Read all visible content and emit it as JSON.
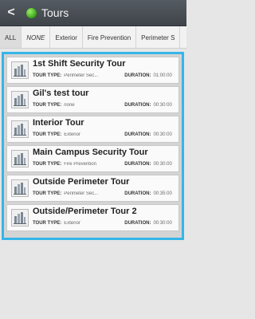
{
  "header": {
    "back_glyph": "<",
    "title": "Tours",
    "status_color": "#4cbf22"
  },
  "tabs": [
    {
      "label": "ALL",
      "active": true,
      "italic": false
    },
    {
      "label": "NONE",
      "active": false,
      "italic": true
    },
    {
      "label": "Exterior",
      "active": false,
      "italic": false
    },
    {
      "label": "Fire Prevention",
      "active": false,
      "italic": false
    },
    {
      "label": "Perimeter S",
      "active": false,
      "italic": false
    }
  ],
  "labels": {
    "tour_type": "TOUR TYPE:",
    "duration": "DURATION:"
  },
  "tours": [
    {
      "name": "1st Shift Security Tour",
      "type": "Perimeter Sec...",
      "type_italic": false,
      "duration": "01:00:00"
    },
    {
      "name": "Gil's test tour",
      "type": "none",
      "type_italic": true,
      "duration": "00:30:00"
    },
    {
      "name": "Interior Tour",
      "type": "Exterior",
      "type_italic": false,
      "duration": "00:30:00"
    },
    {
      "name": "Main Campus Security Tour",
      "type": "Fire Prevention",
      "type_italic": false,
      "duration": "00:30:00"
    },
    {
      "name": "Outside Perimeter Tour",
      "type": "Perimeter Sec...",
      "type_italic": false,
      "duration": "00:35:00"
    },
    {
      "name": "Outside/Perimeter Tour 2",
      "type": "Exterior",
      "type_italic": false,
      "duration": "00:30:00"
    }
  ],
  "colors": {
    "accent": "#35b6e8",
    "header_bg": "#4a4f55"
  },
  "icons": {
    "back": "back-arrow-icon",
    "status": "status-indicator-icon",
    "tour": "tour-building-icon"
  }
}
